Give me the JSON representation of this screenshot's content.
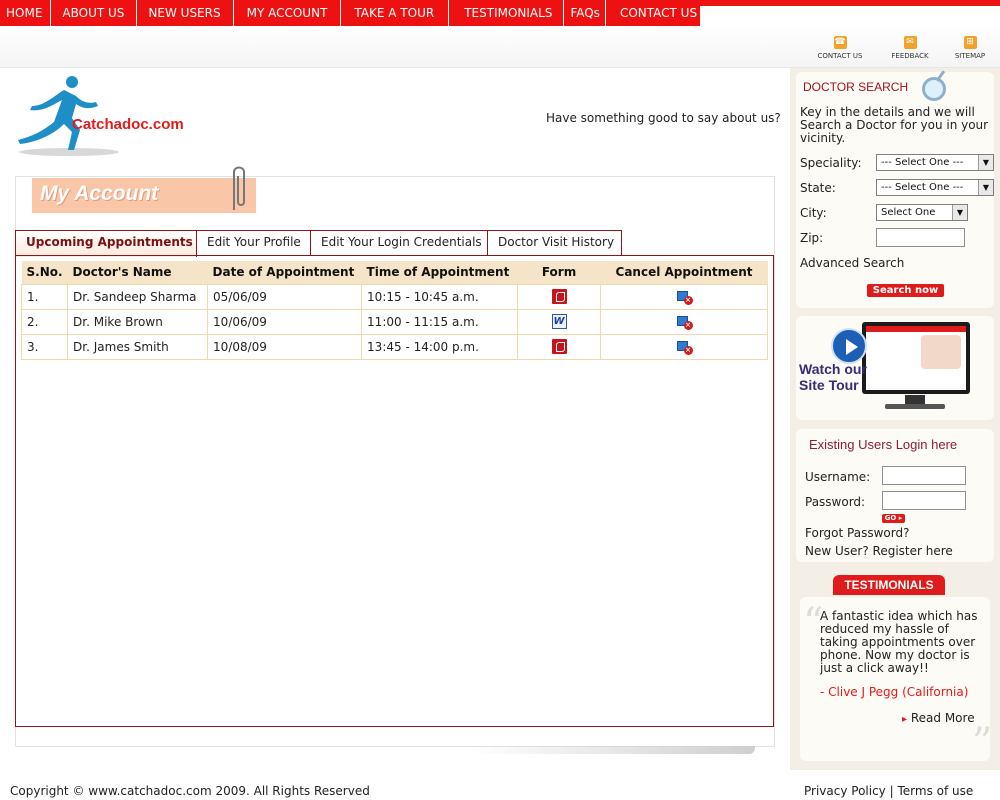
{
  "nav": [
    "HOME",
    "ABOUT US",
    "NEW USERS",
    "MY ACCOUNT",
    "TAKE A TOUR",
    "TESTIMONIALS",
    "FAQs",
    "CONTACT US"
  ],
  "utility": {
    "contact": "CONTACT US",
    "feedback": "FEEDBACK",
    "sitemap": "SITEMAP"
  },
  "logo": "Catchadoc.com",
  "tagline": "Have something good to say about us?",
  "banner": "My Account",
  "tabs": [
    "Upcoming Appointments",
    "Edit Your Profile",
    "Edit Your Login Credentials",
    "Doctor Visit History"
  ],
  "table": {
    "headers": [
      "S.No.",
      "Doctor's Name",
      "Date of Appointment",
      "Time of Appointment",
      "Form",
      "Cancel Appointment"
    ],
    "rows": [
      {
        "sno": "1.",
        "doctor": "Dr. Sandeep Sharma",
        "date": "05/06/09",
        "time": "10:15 - 10:45 a.m.",
        "form": "pdf-icon"
      },
      {
        "sno": "2.",
        "doctor": "Dr. Mike Brown",
        "date": "10/06/09",
        "time": "11:00 - 11:15 a.m.",
        "form": "word-doc-icon"
      },
      {
        "sno": "3.",
        "doctor": "Dr. James Smith",
        "date": "10/08/09",
        "time": "13:45 - 14:00 p.m.",
        "form": "pdf-icon"
      }
    ]
  },
  "doctor_search": {
    "title": "DOCTOR SEARCH",
    "intro": "Key in the details and we will Search a Doctor for you in your vicinity.",
    "speciality_label": "Speciality:",
    "speciality_value": "--- Select One ---",
    "state_label": "State:",
    "state_value": "--- Select One ---",
    "city_label": "City:",
    "city_value": "Select One",
    "zip_label": "Zip:",
    "advanced": "Advanced Search",
    "button": "Search now"
  },
  "tour": {
    "line1": "Watch our",
    "line2": "Site Tour"
  },
  "login": {
    "title": "Existing Users Login here",
    "username_label": "Username:",
    "password_label": "Password:",
    "go": "GO",
    "forgot": "Forgot Password?",
    "register": "New User? Register here"
  },
  "testimonial": {
    "heading": "TESTIMONIALS",
    "text": "A fantastic idea which has reduced my hassle of taking appointments over phone. Now my doctor is just a click away!!",
    "author": "- Clive J Pegg (California)",
    "read_more": "Read More"
  },
  "footer": {
    "copyright": "Copyright © www.catchadoc.com 2009. All Rights Reserved",
    "privacy": "Privacy Policy",
    "sep": "|",
    "terms": "Terms of use"
  }
}
